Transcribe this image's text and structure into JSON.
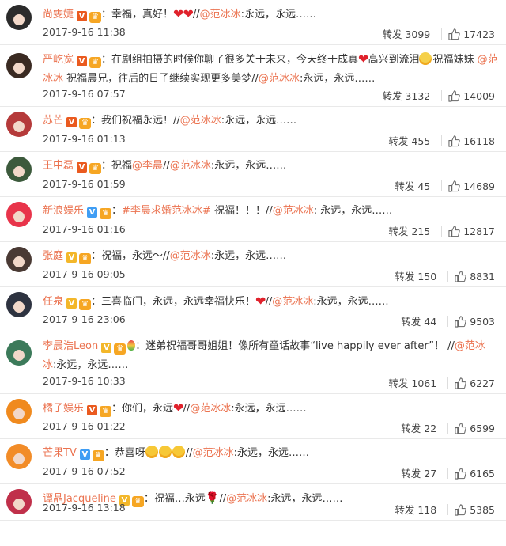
{
  "comments": [
    {
      "user": "尚雯婕",
      "badge": "V",
      "badge_color": "red",
      "crown": true,
      "segments": [
        {
          "t": "text",
          "v": "：幸福，真好！"
        },
        {
          "t": "heart",
          "v": "❤❤"
        },
        {
          "t": "text",
          "v": "//"
        },
        {
          "t": "mention",
          "v": "@范冰冰"
        },
        {
          "t": "text",
          "v": ":永远，永远……"
        }
      ],
      "date": "2017-9-16 11:38",
      "repost": "转发 3099",
      "likes": "17423",
      "avatar_color": "#2b2b2b"
    },
    {
      "user": "严屹宽",
      "badge": "V",
      "badge_color": "red",
      "crown": true,
      "segments": [
        {
          "t": "text",
          "v": "：在剧组拍摄的时候你聊了很多关于未来，今天终于成真"
        },
        {
          "t": "heart",
          "v": "❤"
        },
        {
          "t": "text",
          "v": "高兴到流泪"
        },
        {
          "t": "emoji",
          "v": "cry"
        },
        {
          "t": "text",
          "v": "祝福妹妹 "
        },
        {
          "t": "mention",
          "v": "@范冰冰"
        },
        {
          "t": "text",
          "v": " 祝福晨兄，往后的日子继续实现更多美梦//"
        },
        {
          "t": "mention",
          "v": "@范冰冰"
        },
        {
          "t": "text",
          "v": ":永远，永远……"
        }
      ],
      "date": "2017-9-16 07:57",
      "repost": "转发 3132",
      "likes": "14009",
      "avatar_color": "#3a2a22"
    },
    {
      "user": "苏芒",
      "badge": "V",
      "badge_color": "red",
      "crown": true,
      "segments": [
        {
          "t": "text",
          "v": "：我们祝福永远！//"
        },
        {
          "t": "mention",
          "v": "@范冰冰"
        },
        {
          "t": "text",
          "v": ":永远，永远……"
        }
      ],
      "date": "2017-9-16 01:13",
      "repost": "转发 455",
      "likes": "16118",
      "avatar_color": "#b53a3a"
    },
    {
      "user": "王中磊",
      "badge": "V",
      "badge_color": "red",
      "crown": true,
      "segments": [
        {
          "t": "text",
          "v": "：祝福"
        },
        {
          "t": "mention",
          "v": "@李晨"
        },
        {
          "t": "text",
          "v": "//"
        },
        {
          "t": "mention",
          "v": "@范冰冰"
        },
        {
          "t": "text",
          "v": ":永远，永远……"
        }
      ],
      "date": "2017-9-16 01:59",
      "repost": "转发 45",
      "likes": "14689",
      "avatar_color": "#3c5a3c"
    },
    {
      "user": "新浪娱乐",
      "badge": "V",
      "badge_color": "blue",
      "crown": true,
      "segments": [
        {
          "t": "text",
          "v": "："
        },
        {
          "t": "topic",
          "v": "#李晨求婚范冰冰#"
        },
        {
          "t": "text",
          "v": " 祝福！！！//"
        },
        {
          "t": "mention",
          "v": "@范冰冰"
        },
        {
          "t": "text",
          "v": ": 永远，永远……"
        }
      ],
      "date": "2017-9-16 01:16",
      "repost": "转发 215",
      "likes": "12817",
      "avatar_color": "#e8344a"
    },
    {
      "user": "张庭",
      "badge": "V",
      "badge_color": "gold",
      "crown": true,
      "segments": [
        {
          "t": "text",
          "v": "：祝福，永远～//"
        },
        {
          "t": "mention",
          "v": "@范冰冰"
        },
        {
          "t": "text",
          "v": ":永远，永远……"
        }
      ],
      "date": "2017-9-16 09:05",
      "repost": "转发 150",
      "likes": "8831",
      "avatar_color": "#4a3a34"
    },
    {
      "user": "任泉",
      "badge": "V",
      "badge_color": "gold",
      "crown": true,
      "segments": [
        {
          "t": "text",
          "v": "：三喜临门，永远，永远幸福快乐！"
        },
        {
          "t": "heart",
          "v": "❤"
        },
        {
          "t": "text",
          "v": "//"
        },
        {
          "t": "mention",
          "v": "@范冰冰"
        },
        {
          "t": "text",
          "v": ":永远，永远……"
        }
      ],
      "date": "2017-9-16 23:06",
      "repost": "转发 44",
      "likes": "9503",
      "avatar_color": "#2e3340"
    },
    {
      "user": "李晨浩Leon",
      "badge": "V",
      "badge_color": "gold",
      "crown": true,
      "segments": [
        {
          "t": "balloon",
          "v": ""
        },
        {
          "t": "text",
          "v": "：迷弟祝福哥哥姐姐！像所有童话故事“live happily ever after”！ //"
        },
        {
          "t": "mention",
          "v": "@范冰冰"
        },
        {
          "t": "text",
          "v": ":永远，永远……"
        }
      ],
      "date": "2017-9-16 10:33",
      "repost": "转发 1061",
      "likes": "6227",
      "avatar_color": "#3c7a5a"
    },
    {
      "user": "橘子娱乐",
      "badge": "V",
      "badge_color": "red",
      "crown": true,
      "segments": [
        {
          "t": "text",
          "v": "：你们，永远"
        },
        {
          "t": "heart",
          "v": "❤"
        },
        {
          "t": "text",
          "v": "//"
        },
        {
          "t": "mention",
          "v": "@范冰冰"
        },
        {
          "t": "text",
          "v": ":永远，永远……"
        }
      ],
      "date": "2017-9-16 01:22",
      "repost": "转发 22",
      "likes": "6599",
      "avatar_color": "#f08a1e"
    },
    {
      "user": "芒果TV",
      "badge": "V",
      "badge_color": "blue",
      "crown": true,
      "segments": [
        {
          "t": "text",
          "v": "：恭喜呀"
        },
        {
          "t": "emoji",
          "v": "smile"
        },
        {
          "t": "emoji",
          "v": "smile"
        },
        {
          "t": "emoji",
          "v": "smile"
        },
        {
          "t": "text",
          "v": "//"
        },
        {
          "t": "mention",
          "v": "@范冰冰"
        },
        {
          "t": "text",
          "v": ":永远，永远……"
        }
      ],
      "date": "2017-9-16 07:52",
      "repost": "转发 27",
      "likes": "6165",
      "avatar_color": "#f28c28"
    },
    {
      "user": "谭晶Jacqueline",
      "badge": "V",
      "badge_color": "gold",
      "crown": true,
      "segments": [
        {
          "t": "text",
          "v": "：祝福…永远"
        },
        {
          "t": "rose",
          "v": "🌹"
        },
        {
          "t": "text",
          "v": "//"
        },
        {
          "t": "mention",
          "v": "@范冰冰"
        },
        {
          "t": "text",
          "v": ":永远，永远……"
        }
      ],
      "date": "2017-9-16 13:18",
      "repost": "转发 118",
      "likes": "5385",
      "avatar_color": "#c0304a"
    }
  ]
}
